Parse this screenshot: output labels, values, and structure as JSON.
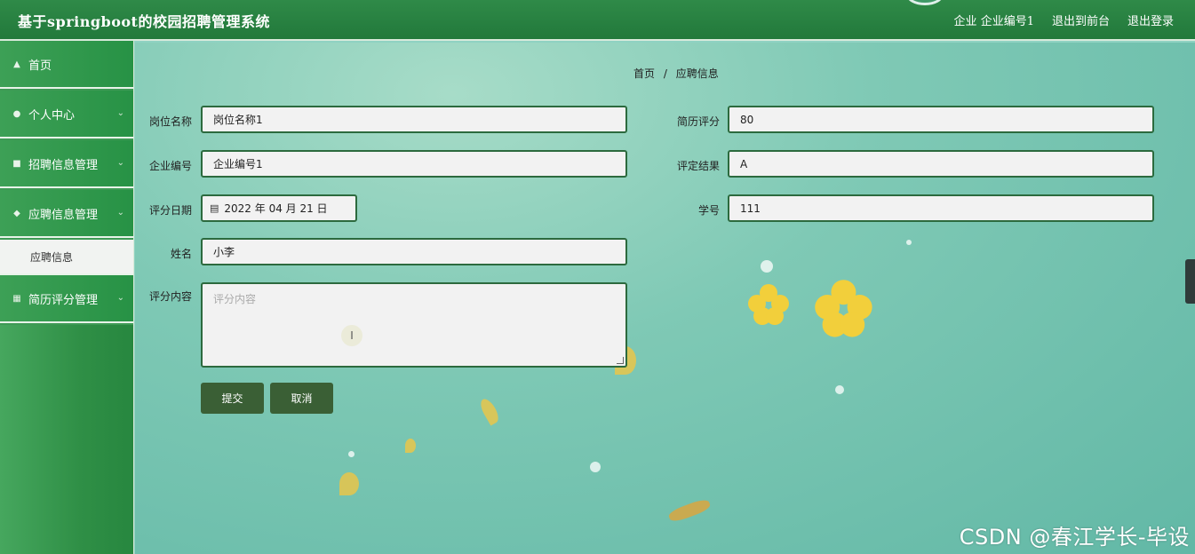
{
  "header": {
    "title": "基于springboot的校园招聘管理系统",
    "role": "企业",
    "user": "企业编号1",
    "frontend_link": "退出到前台",
    "logout_link": "退出登录"
  },
  "sidebar": {
    "items": [
      {
        "label": "首页",
        "icon": "home-icon",
        "expandable": false
      },
      {
        "label": "个人中心",
        "icon": "user-icon",
        "expandable": true
      },
      {
        "label": "招聘信息管理",
        "icon": "briefcase-icon",
        "expandable": true
      },
      {
        "label": "应聘信息管理",
        "icon": "thumb-icon",
        "expandable": true
      },
      {
        "label": "简历评分管理",
        "icon": "grid-icon",
        "expandable": true
      }
    ],
    "submenu_active": "应聘信息"
  },
  "breadcrumb": {
    "home": "首页",
    "separator": "/",
    "current": "应聘信息"
  },
  "form": {
    "position_label": "岗位名称",
    "position_value": "岗位名称1",
    "company_label": "企业编号",
    "company_value": "企业编号1",
    "date_label": "评分日期",
    "date_value": "2022 年 04 月 21 日",
    "name_label": "姓名",
    "name_value": "小李",
    "content_label": "评分内容",
    "content_placeholder": "评分内容",
    "score_label": "简历评分",
    "score_value": "80",
    "result_label": "评定结果",
    "result_value": "A",
    "student_label": "学号",
    "student_value": "111"
  },
  "buttons": {
    "submit": "提交",
    "cancel": "取消"
  },
  "watermark": "CSDN @春江学长-毕设",
  "colors": {
    "header": "#22793b",
    "sidebar": "#2f8f46",
    "field_border": "#2c6a3e",
    "button": "#3a5f35"
  }
}
